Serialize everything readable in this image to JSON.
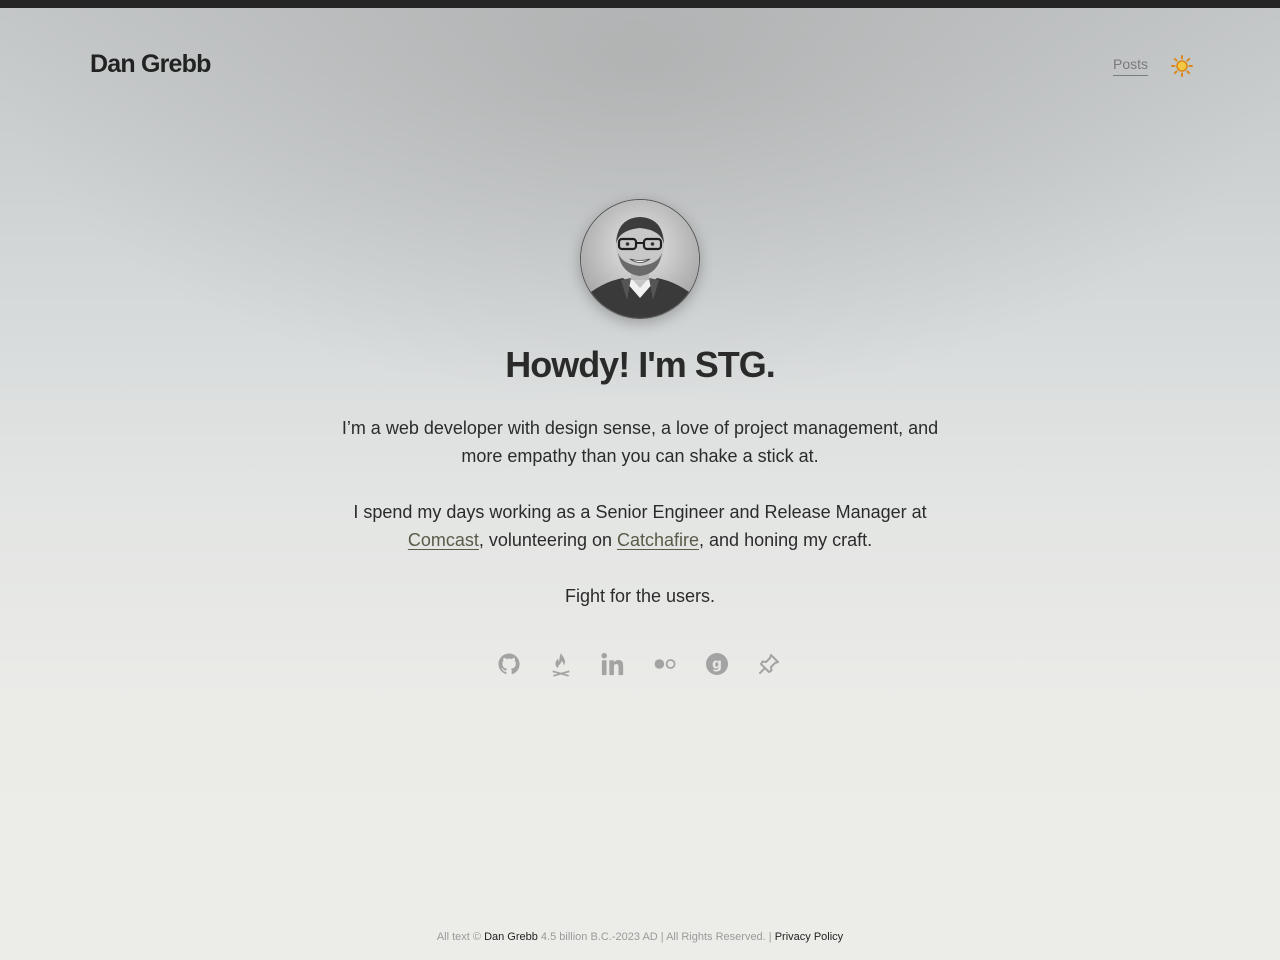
{
  "header": {
    "site_title": "Dan Grebb",
    "nav": [
      {
        "label": "Posts"
      }
    ],
    "theme_toggle_icon": "sun-icon",
    "theme_toggle_color": "#d9891a"
  },
  "hero": {
    "avatar_icon": "profile-photo",
    "headline": "Howdy! I'm STG.",
    "intro": "I’m a web developer with design sense, a love of project management, and more empathy than you can shake a stick at.",
    "work_prefix": "I spend my days working as a Senior Engineer and Release Manager at ",
    "work_link_1": "Comcast",
    "work_middle": ", volunteering on ",
    "work_link_2": "Catchafire",
    "work_suffix": ", and honing my craft.",
    "motto": "Fight for the users."
  },
  "social": [
    {
      "icon": "github-icon"
    },
    {
      "icon": "campfire-icon"
    },
    {
      "icon": "linkedin-icon"
    },
    {
      "icon": "flickr-icon"
    },
    {
      "icon": "goodreads-icon"
    },
    {
      "icon": "pin-icon"
    }
  ],
  "footer": {
    "prefix": "All text © ",
    "author": "Dan Grebb",
    "middle": " 4.5 billion B.C.-2023 AD | All Rights Reserved. | ",
    "privacy": "Privacy Policy"
  },
  "colors": {
    "text": "#2a2a2a",
    "muted": "#9a9a9a",
    "icon": "#a3a3a3",
    "topbar": "#252525"
  }
}
